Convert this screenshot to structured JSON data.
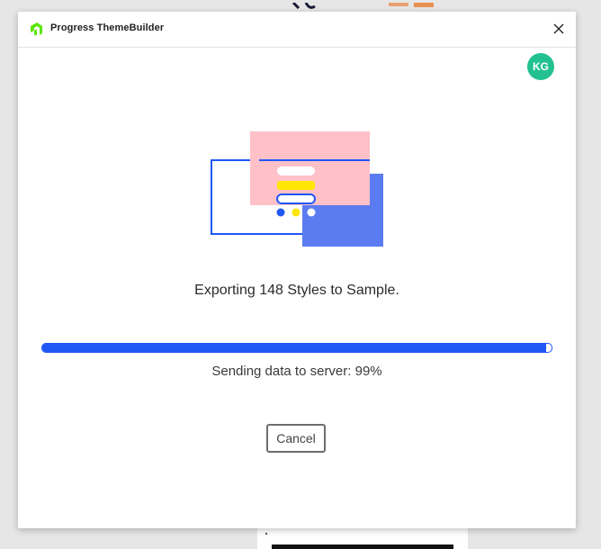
{
  "app": {
    "title": "Progress ThemeBuilder",
    "brand_color": "#5CE500"
  },
  "user": {
    "initials": "KG",
    "avatar_color": "#23C191"
  },
  "export": {
    "title": "Exporting 148 Styles to Sample.",
    "status": "Sending data to server: 99%",
    "progress_percent": 99,
    "progress_color": "#2057F5"
  },
  "actions": {
    "cancel_label": "Cancel"
  },
  "icons": {
    "logo": "progress-logo-icon",
    "close": "close-icon"
  },
  "illustration": {
    "colors": {
      "pink": "#FFC0C8",
      "blue": "#2057F5",
      "blue_light": "#5B7CF0",
      "yellow": "#FFE600",
      "white": "#FFFFFF"
    }
  }
}
